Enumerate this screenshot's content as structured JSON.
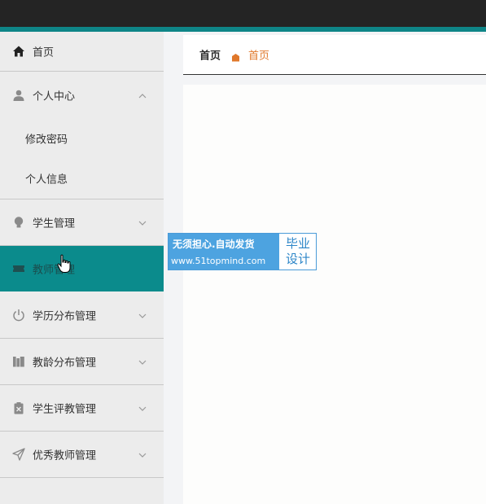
{
  "breadcrumb": {
    "root": "首页",
    "current": "首页"
  },
  "sidebar": {
    "home": "首页",
    "personal_center": "个人中心",
    "personal_sub": [
      "修改密码",
      "个人信息"
    ],
    "student_mgmt": "学生管理",
    "teacher_mgmt": "教师管理",
    "education_mgmt": "学历分布管理",
    "teaching_age_mgmt": "教龄分布管理",
    "student_eval_mgmt": "学生评教管理",
    "excellent_teacher_mgmt": "优秀教师管理"
  },
  "watermark": {
    "line1": "无须担心.自动发货",
    "line2": "www.51topmind.com",
    "right_line1": "毕业",
    "right_line2": "设计"
  },
  "colors": {
    "accent": "#0b8b8c",
    "breadcrumb_current": "#e0782b",
    "topbar": "#242424"
  },
  "icons": {
    "home": "home-icon",
    "personal_center": "user-icon",
    "student_mgmt": "lightbulb-icon",
    "teacher_mgmt": "ticket-icon",
    "education_mgmt": "power-icon",
    "teaching_age_mgmt": "books-icon",
    "student_eval_mgmt": "clipboard-icon",
    "excellent_teacher_mgmt": "send-icon"
  }
}
